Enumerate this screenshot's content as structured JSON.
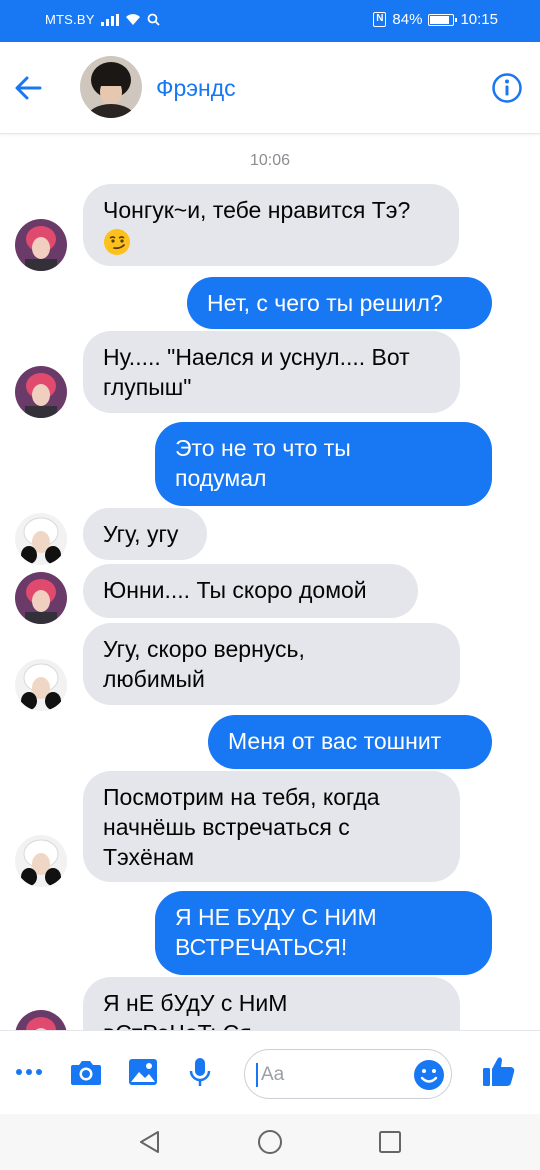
{
  "status_bar": {
    "carrier": "MTS.BY",
    "battery": "84%",
    "battery_level": 0.84,
    "time": "10:15",
    "icons": [
      "signal-icon",
      "wifi-icon",
      "search-icon",
      "nfc-icon",
      "battery-icon"
    ]
  },
  "header": {
    "title": "Фрэндс",
    "back_icon": "back-arrow-icon",
    "info_icon": "info-icon"
  },
  "chat": {
    "timestamp": "10:06",
    "messages": [
      {
        "side": "in",
        "line1": "Чонгук~и, тебе нравится Тэ?",
        "emoji": "smirk-emoji"
      },
      {
        "side": "out",
        "line1": "Нет, с чего ты решил?"
      },
      {
        "side": "in",
        "line1": "Ну..... \"Наелся и уснул.... Вот",
        "line2": "глупыш\""
      },
      {
        "side": "out",
        "line1": "Это не то что ты",
        "line2": "подумал"
      },
      {
        "side": "in",
        "line1": "Угу, угу"
      },
      {
        "side": "in",
        "line1": "Юнни.... Ты скоро домой"
      },
      {
        "side": "in",
        "line1": "Угу, скоро вернусь,",
        "line2": "любимый"
      },
      {
        "side": "out",
        "line1": "Меня от вас тошнит"
      },
      {
        "side": "in",
        "line1": "Посмотрим на тебя, когда",
        "line2": "начнёшь встречаться с",
        "line3": "Тэхёнам"
      },
      {
        "side": "out",
        "line1": "Я НЕ БУДУ С НИМ",
        "line2": "ВСТРЕЧАТЬСЯ!"
      },
      {
        "side": "in",
        "line1": "Я нЕ бУдУ с НиМ",
        "line2": "вСтРеЧаТьСя"
      }
    ]
  },
  "composer": {
    "placeholder": "Aa",
    "tools": [
      "more-icon",
      "camera-icon",
      "gallery-icon",
      "microphone-icon"
    ],
    "emoji_icon": "emoji-icon",
    "like_icon": "thumbs-up-icon"
  },
  "navbar": {
    "icons": [
      "back-triangle-icon",
      "home-circle-icon",
      "recents-square-icon"
    ]
  },
  "colors": {
    "accent": "#1877f2",
    "incoming_bubble": "#e4e6eb",
    "timestamp": "#8a8d91"
  }
}
